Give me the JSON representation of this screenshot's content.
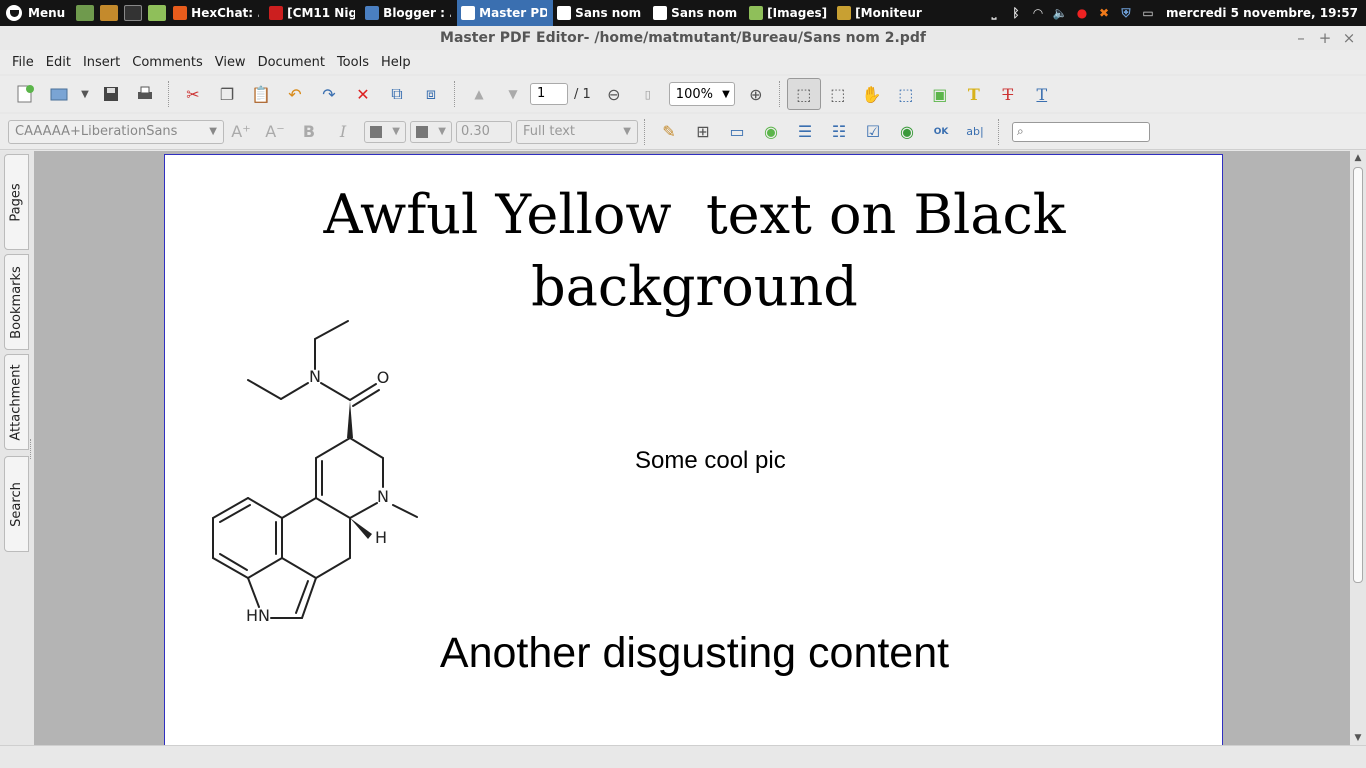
{
  "taskbar": {
    "menu_label": "Menu",
    "tasks": [
      {
        "label": "HexChat: ...",
        "icon": "hexchat-icon",
        "color": "#e85c1c"
      },
      {
        "label": "[CM11 Nig...",
        "icon": "opera-icon",
        "color": "#cc1f1f"
      },
      {
        "label": "Blogger : ...",
        "icon": "blogger-icon",
        "color": "#4a7fc1"
      },
      {
        "label": "Master PD...",
        "icon": "pdf-editor-icon",
        "color": "#ffffff",
        "active": true
      },
      {
        "label": "Sans nom ...",
        "icon": "document-icon",
        "color": "#ffffff"
      },
      {
        "label": "Sans nom ...",
        "icon": "document-icon",
        "color": "#ffffff"
      },
      {
        "label": "[Images]",
        "icon": "folder-icon",
        "color": "#8fbf5a"
      },
      {
        "label": "[Moniteur ...",
        "icon": "monitor-icon",
        "color": "#c8a032"
      }
    ],
    "clock": "mercredi 5 novembre, 19:57"
  },
  "window": {
    "title": "Master PDF Editor- /home/matmutant/Bureau/Sans nom 2.pdf"
  },
  "menubar": [
    "File",
    "Edit",
    "Insert",
    "Comments",
    "View",
    "Document",
    "Tools",
    "Help"
  ],
  "toolbar": {
    "page_current": "1",
    "page_total": "/ 1",
    "zoom": "100%"
  },
  "format_toolbar": {
    "font": "CAAAAA+LiberationSans",
    "line_width": "0.30",
    "text_mode": "Full text",
    "search_placeholder": ""
  },
  "side_tabs": [
    "Pages",
    "Bookmarks",
    "Attachment",
    "Search"
  ],
  "document": {
    "title_line1": "Awful Yellow  text on Black",
    "title_line2": "background",
    "caption": "Some cool pic",
    "bottom_text": "Another disgusting content",
    "molecule_labels": {
      "n_amide": "N",
      "o": "O",
      "n_ring": "N",
      "h": "H",
      "hn": "HN"
    }
  }
}
